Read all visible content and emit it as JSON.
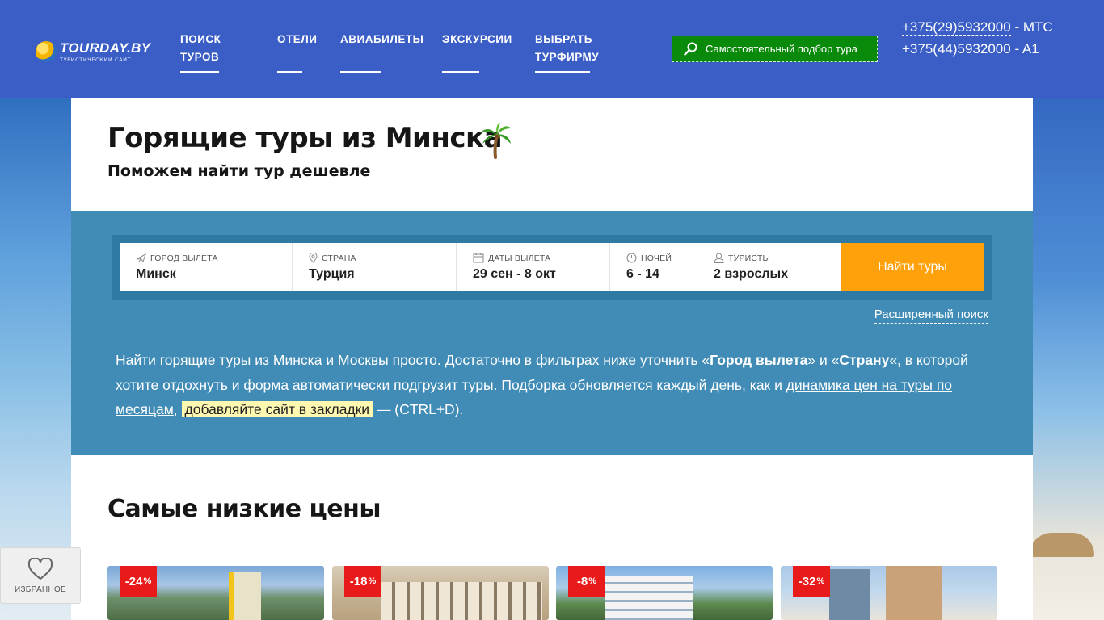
{
  "header": {
    "logo_name": "TOURDAY.BY",
    "logo_sub": "ТУРИСТИЧЕСКИЙ САЙТ",
    "nav": [
      {
        "label_line1": "ПОИСК",
        "label_line2": "ТУРОВ"
      },
      {
        "label_line1": "ОТЕЛИ",
        "label_line2": ""
      },
      {
        "label_line1": "АВИАБИЛЕТЫ",
        "label_line2": ""
      },
      {
        "label_line1": "ЭКСКУРСИИ",
        "label_line2": ""
      },
      {
        "label_line1": "ВЫБРАТЬ",
        "label_line2": "ТУРФИРМУ"
      }
    ],
    "self_select_button": "Самостоятельный подбор тура",
    "phones": [
      {
        "number": "+375(29)5932000",
        "operator": " - МТС"
      },
      {
        "number": "+375(44)5932000",
        "operator": " - A1"
      }
    ]
  },
  "page": {
    "title": "Горящие туры из Минска",
    "subtitle": "Поможем найти тур дешевле"
  },
  "search": {
    "fields": [
      {
        "label": "ГОРОД ВЫЛЕТА",
        "value": "Минск",
        "icon": "plane-icon"
      },
      {
        "label": "СТРАНА",
        "value": "Турция",
        "icon": "location-pin-icon"
      },
      {
        "label": "ДАТЫ ВЫЛЕТА",
        "value": "29 сен - 8 окт",
        "icon": "calendar-icon"
      },
      {
        "label": "НОЧЕЙ",
        "value": "6 - 14",
        "icon": "clock-icon"
      },
      {
        "label": "ТУРИСТЫ",
        "value": "2 взрослых",
        "icon": "person-icon"
      }
    ],
    "submit_label": "Найти туры",
    "advanced_link": "Расширенный поиск"
  },
  "intro": {
    "t1": "Найти горящие туры из Минска и Москвы просто. Достаточно в фильтрах ниже уточнить «",
    "b1": "Город вылета",
    "t2": "» и «",
    "b2": "Страну",
    "t3": "«, в которой хотите отдохнуть и форма автоматически подгрузит туры. Подборка обновляется каждый день, как и ",
    "link1": "динамика цен на туры по месяцам",
    "t4": ", ",
    "highlight": "добавляйте сайт в закладки",
    "t5": " — (CTRL+D)."
  },
  "lowest": {
    "title": "Самые низкие цены",
    "cards": [
      {
        "discount": "-24",
        "unit": "%"
      },
      {
        "discount": "-18",
        "unit": "%"
      },
      {
        "discount": "-8",
        "unit": "%"
      },
      {
        "discount": "-32",
        "unit": "%"
      }
    ]
  },
  "favorites": {
    "label": "ИЗБРАННОЕ"
  },
  "colors": {
    "header_bg": "#3a5ec6",
    "search_section_bg": "#418cb7",
    "find_button": "#ffa10b",
    "self_select_button": "#0a8a0a",
    "discount_badge": "#e81a1a"
  }
}
